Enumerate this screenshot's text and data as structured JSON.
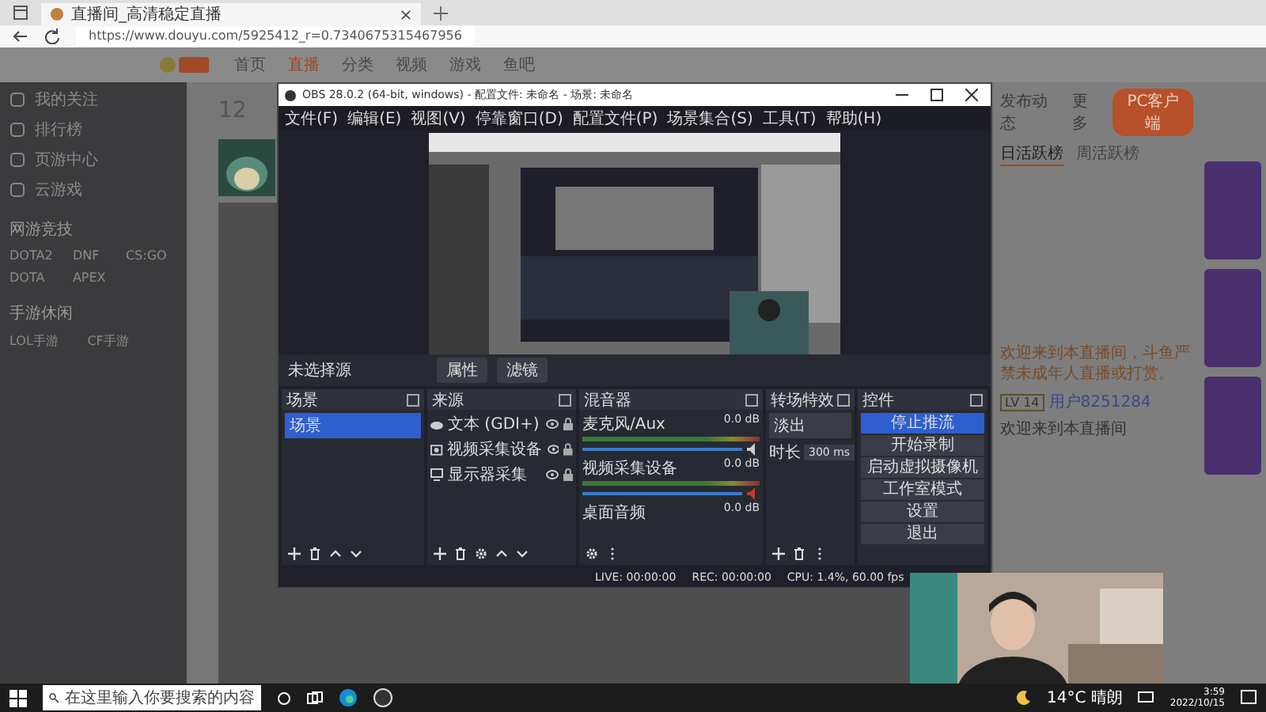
{
  "browser": {
    "tab_title": "直播间_高清稳定直播",
    "url": "https://www.douyu.com/5925412_r=0.7340675315467956"
  },
  "site": {
    "nav": [
      {
        "label": "首页",
        "selected": false
      },
      {
        "label": "直播",
        "selected": true
      },
      {
        "label": "分类",
        "selected": false
      },
      {
        "label": "视频",
        "selected": false
      },
      {
        "label": "游戏",
        "selected": false
      },
      {
        "label": "鱼吧",
        "selected": false
      }
    ],
    "menu": [
      "我的关注",
      "排行榜",
      "页游中心",
      "云游戏"
    ],
    "sections": [
      {
        "title": "网游竞技",
        "items": [
          "DOTA2",
          "DNF",
          "CS:GO",
          "DOTA",
          "APEX"
        ]
      },
      {
        "title": "手游休闲",
        "items": [
          "LOL手游",
          "CF手游"
        ]
      }
    ],
    "count": "12",
    "actions": [
      "发布动态",
      "更多"
    ],
    "client_button": "PC客户端",
    "rank_tabs": [
      {
        "label": "日活跃榜",
        "selected": true
      },
      {
        "label": "周活跃榜",
        "selected": false
      }
    ]
  },
  "obs": {
    "title": "OBS 28.0.2 (64-bit, windows) - 配置文件: 未命名 - 场景: 未命名",
    "menu": [
      "文件(F)",
      "编辑(E)",
      "视图(V)",
      "停靠窗口(D)",
      "配置文件(P)",
      "场景集合(S)",
      "工具(T)",
      "帮助(H)"
    ],
    "no_source": "未选择源",
    "source_buttons": [
      "属性",
      "滤镜"
    ],
    "scenes": {
      "title": "场景",
      "items": [
        {
          "label": "场景",
          "selected": true
        }
      ]
    },
    "sources": {
      "title": "来源",
      "items": [
        {
          "label": "文本 (GDI+)",
          "kind": "text"
        },
        {
          "label": "视频采集设备",
          "kind": "camera"
        },
        {
          "label": "显示器采集",
          "kind": "monitor"
        }
      ]
    },
    "mixer": {
      "title": "混音器",
      "channels": [
        {
          "name": "麦克风/Aux",
          "reading": "0.0 dB",
          "level": 1,
          "muted": false
        },
        {
          "name": "视频采集设备",
          "reading": "0.0 dB",
          "level": 1,
          "muted": true
        },
        {
          "name": "桌面音频",
          "reading": "0.0 dB"
        }
      ]
    },
    "transitions": {
      "title": "转场特效",
      "type": "淡出",
      "duration_label": "时长",
      "duration": "300 ms"
    },
    "controls": {
      "title": "控件",
      "buttons": [
        {
          "label": "停止推流",
          "selected": true
        },
        {
          "label": "开始录制",
          "selected": false
        },
        {
          "label": "启动虚拟摄像机",
          "selected": false
        },
        {
          "label": "工作室模式",
          "selected": false
        },
        {
          "label": "设置",
          "selected": false
        },
        {
          "label": "退出",
          "selected": false
        }
      ]
    },
    "status": [
      "LIVE: 00:00:00",
      "REC: 00:00:00",
      "CPU: 1.4%, 60.00 fps"
    ]
  },
  "chat": {
    "notice": "欢迎来到本直播间，斗鱼严禁未成年人直播或打赏。",
    "messages": [
      {
        "level": "LV 14",
        "name": "用户8251284",
        "text": "欢迎来到本直播间"
      }
    ]
  },
  "taskbar": {
    "search_placeholder": "在这里输入你要搜索的内容",
    "weather": "14°C 晴朗",
    "time": "3:59",
    "date": "2022/10/15"
  }
}
